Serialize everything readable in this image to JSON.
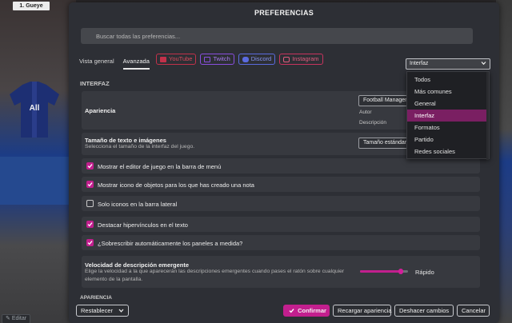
{
  "background": {
    "nameplate": "1. Gueye",
    "edit_button": "Editar"
  },
  "dialog": {
    "title": "PREFERENCIAS",
    "search_placeholder": "Buscar todas las preferencias...",
    "tabs": [
      {
        "label": "Vista general",
        "active": false
      },
      {
        "label": "Avanzada",
        "active": true
      }
    ],
    "social_links": [
      {
        "label": "YouTube",
        "icon": "youtube-icon",
        "color": "#c2314a"
      },
      {
        "label": "Twitch",
        "icon": "twitch-icon",
        "color": "#8a4fe0"
      },
      {
        "label": "Discord",
        "icon": "discord-icon",
        "color": "#5b6bdf"
      },
      {
        "label": "Instagram",
        "icon": "instagram-icon",
        "color": "#c8345f"
      }
    ],
    "section_interfaz": "INTERFAZ",
    "appearance": {
      "title": "Apariencia",
      "button": "Football Manager",
      "autor_label": "Autor",
      "descripcion_label": "Descripción"
    },
    "text_size": {
      "title": "Tamaño de texto e imágenes",
      "subtitle": "Selecciona el tamaño de la interfaz del juego.",
      "button": "Tamaño estándar"
    },
    "checkboxes": [
      {
        "label": "Mostrar el editor de juego en la barra de menú",
        "checked": true
      },
      {
        "label": "Mostrar icono de objetos para los que has creado una nota",
        "checked": true
      },
      {
        "label": "Solo iconos en la barra lateral",
        "checked": false
      },
      {
        "label": "Destacar hipervínculos en el texto",
        "checked": true
      },
      {
        "label": "¿Sobrescribir automáticamente los paneles a medida?",
        "checked": true
      }
    ],
    "tooltip_speed": {
      "title": "Velocidad de descripción emergente",
      "subtitle_line1": "Elige la velocidad a la que aparecerán las descripciones emergentes cuando pases el ratón sobre cualquier",
      "subtitle_line2": "elemento de la pantalla.",
      "value_label": "Rápido",
      "level": 0.85
    },
    "section_apariencia": "APARIENCIA",
    "dropdown": {
      "selected": "Interfaz",
      "options": [
        "Todos",
        "Más comunes",
        "General",
        "Interfaz",
        "Formatos",
        "Partido",
        "Redes sociales"
      ]
    },
    "footer": {
      "reset": "Restablecer",
      "confirm": "Confirmar",
      "reload": "Recargar apariencia",
      "undo": "Deshacer cambios",
      "cancel": "Cancelar"
    }
  },
  "colors": {
    "accent": "#c21f8e",
    "dialog_bg": "#2d2f35",
    "selected_menu": "#7a1f62"
  }
}
